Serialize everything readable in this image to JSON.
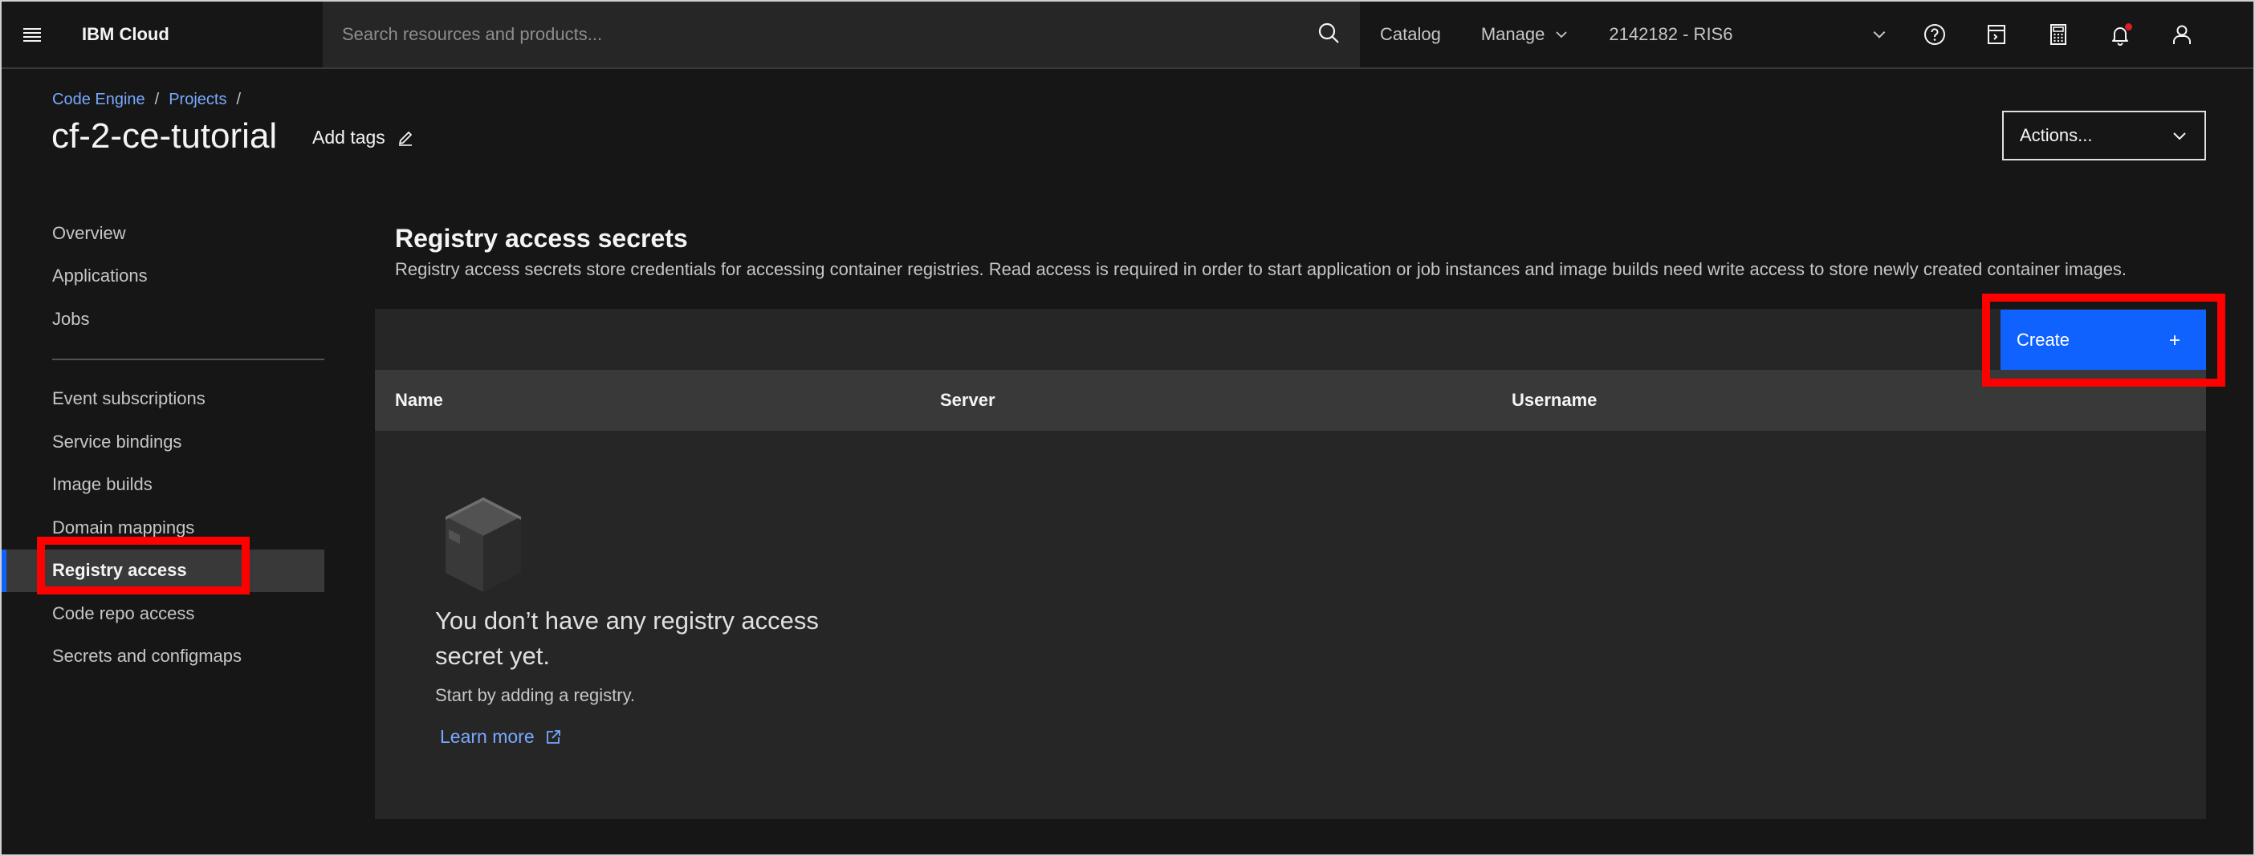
{
  "header": {
    "brand": "IBM Cloud",
    "search_placeholder": "Search resources and products...",
    "catalog": "Catalog",
    "manage": "Manage",
    "account": "2142182 - RIS6"
  },
  "breadcrumb": {
    "items": [
      "Code Engine",
      "Projects"
    ],
    "separator": "/"
  },
  "page": {
    "title": "cf-2-ce-tutorial",
    "add_tags": "Add tags",
    "actions": "Actions..."
  },
  "sidebar": {
    "group1": [
      "Overview",
      "Applications",
      "Jobs"
    ],
    "group2": [
      "Event subscriptions",
      "Service bindings",
      "Image builds",
      "Domain mappings",
      "Registry access",
      "Code repo access",
      "Secrets and configmaps"
    ],
    "active": "Registry access"
  },
  "content": {
    "title": "Registry access secrets",
    "description": "Registry access secrets store credentials for accessing container registries. Read access is required in order to start application or job instances and image builds need write access to store newly created container images.",
    "create_label": "Create",
    "columns": [
      "Name",
      "Server",
      "Username"
    ],
    "empty_title": "You don’t have any registry access secret yet.",
    "empty_subtitle": "Start by adding a registry.",
    "learn_more": "Learn more"
  },
  "colors": {
    "accent": "#0f62fe",
    "highlight": "#ff0000",
    "link": "#78a9ff"
  }
}
